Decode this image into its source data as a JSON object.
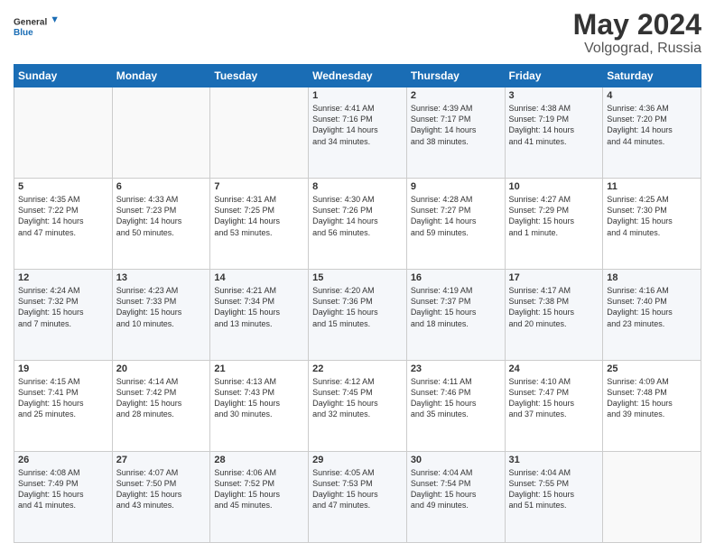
{
  "logo": {
    "line1": "General",
    "line2": "Blue"
  },
  "title": "May 2024",
  "subtitle": "Volgograd, Russia",
  "days_header": [
    "Sunday",
    "Monday",
    "Tuesday",
    "Wednesday",
    "Thursday",
    "Friday",
    "Saturday"
  ],
  "weeks": [
    [
      {
        "day": "",
        "info": ""
      },
      {
        "day": "",
        "info": ""
      },
      {
        "day": "",
        "info": ""
      },
      {
        "day": "1",
        "info": "Sunrise: 4:41 AM\nSunset: 7:16 PM\nDaylight: 14 hours\nand 34 minutes."
      },
      {
        "day": "2",
        "info": "Sunrise: 4:39 AM\nSunset: 7:17 PM\nDaylight: 14 hours\nand 38 minutes."
      },
      {
        "day": "3",
        "info": "Sunrise: 4:38 AM\nSunset: 7:19 PM\nDaylight: 14 hours\nand 41 minutes."
      },
      {
        "day": "4",
        "info": "Sunrise: 4:36 AM\nSunset: 7:20 PM\nDaylight: 14 hours\nand 44 minutes."
      }
    ],
    [
      {
        "day": "5",
        "info": "Sunrise: 4:35 AM\nSunset: 7:22 PM\nDaylight: 14 hours\nand 47 minutes."
      },
      {
        "day": "6",
        "info": "Sunrise: 4:33 AM\nSunset: 7:23 PM\nDaylight: 14 hours\nand 50 minutes."
      },
      {
        "day": "7",
        "info": "Sunrise: 4:31 AM\nSunset: 7:25 PM\nDaylight: 14 hours\nand 53 minutes."
      },
      {
        "day": "8",
        "info": "Sunrise: 4:30 AM\nSunset: 7:26 PM\nDaylight: 14 hours\nand 56 minutes."
      },
      {
        "day": "9",
        "info": "Sunrise: 4:28 AM\nSunset: 7:27 PM\nDaylight: 14 hours\nand 59 minutes."
      },
      {
        "day": "10",
        "info": "Sunrise: 4:27 AM\nSunset: 7:29 PM\nDaylight: 15 hours\nand 1 minute."
      },
      {
        "day": "11",
        "info": "Sunrise: 4:25 AM\nSunset: 7:30 PM\nDaylight: 15 hours\nand 4 minutes."
      }
    ],
    [
      {
        "day": "12",
        "info": "Sunrise: 4:24 AM\nSunset: 7:32 PM\nDaylight: 15 hours\nand 7 minutes."
      },
      {
        "day": "13",
        "info": "Sunrise: 4:23 AM\nSunset: 7:33 PM\nDaylight: 15 hours\nand 10 minutes."
      },
      {
        "day": "14",
        "info": "Sunrise: 4:21 AM\nSunset: 7:34 PM\nDaylight: 15 hours\nand 13 minutes."
      },
      {
        "day": "15",
        "info": "Sunrise: 4:20 AM\nSunset: 7:36 PM\nDaylight: 15 hours\nand 15 minutes."
      },
      {
        "day": "16",
        "info": "Sunrise: 4:19 AM\nSunset: 7:37 PM\nDaylight: 15 hours\nand 18 minutes."
      },
      {
        "day": "17",
        "info": "Sunrise: 4:17 AM\nSunset: 7:38 PM\nDaylight: 15 hours\nand 20 minutes."
      },
      {
        "day": "18",
        "info": "Sunrise: 4:16 AM\nSunset: 7:40 PM\nDaylight: 15 hours\nand 23 minutes."
      }
    ],
    [
      {
        "day": "19",
        "info": "Sunrise: 4:15 AM\nSunset: 7:41 PM\nDaylight: 15 hours\nand 25 minutes."
      },
      {
        "day": "20",
        "info": "Sunrise: 4:14 AM\nSunset: 7:42 PM\nDaylight: 15 hours\nand 28 minutes."
      },
      {
        "day": "21",
        "info": "Sunrise: 4:13 AM\nSunset: 7:43 PM\nDaylight: 15 hours\nand 30 minutes."
      },
      {
        "day": "22",
        "info": "Sunrise: 4:12 AM\nSunset: 7:45 PM\nDaylight: 15 hours\nand 32 minutes."
      },
      {
        "day": "23",
        "info": "Sunrise: 4:11 AM\nSunset: 7:46 PM\nDaylight: 15 hours\nand 35 minutes."
      },
      {
        "day": "24",
        "info": "Sunrise: 4:10 AM\nSunset: 7:47 PM\nDaylight: 15 hours\nand 37 minutes."
      },
      {
        "day": "25",
        "info": "Sunrise: 4:09 AM\nSunset: 7:48 PM\nDaylight: 15 hours\nand 39 minutes."
      }
    ],
    [
      {
        "day": "26",
        "info": "Sunrise: 4:08 AM\nSunset: 7:49 PM\nDaylight: 15 hours\nand 41 minutes."
      },
      {
        "day": "27",
        "info": "Sunrise: 4:07 AM\nSunset: 7:50 PM\nDaylight: 15 hours\nand 43 minutes."
      },
      {
        "day": "28",
        "info": "Sunrise: 4:06 AM\nSunset: 7:52 PM\nDaylight: 15 hours\nand 45 minutes."
      },
      {
        "day": "29",
        "info": "Sunrise: 4:05 AM\nSunset: 7:53 PM\nDaylight: 15 hours\nand 47 minutes."
      },
      {
        "day": "30",
        "info": "Sunrise: 4:04 AM\nSunset: 7:54 PM\nDaylight: 15 hours\nand 49 minutes."
      },
      {
        "day": "31",
        "info": "Sunrise: 4:04 AM\nSunset: 7:55 PM\nDaylight: 15 hours\nand 51 minutes."
      },
      {
        "day": "",
        "info": ""
      }
    ]
  ]
}
